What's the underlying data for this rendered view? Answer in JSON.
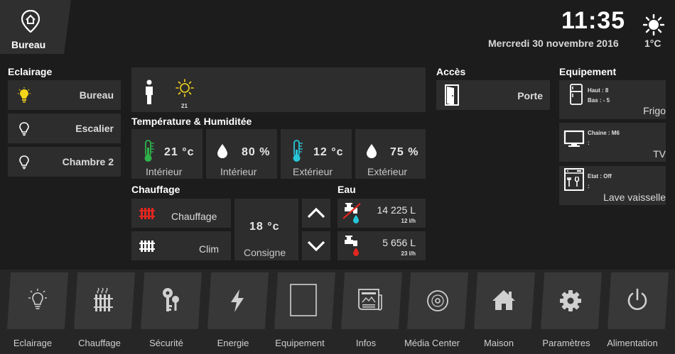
{
  "header": {
    "room": "Bureau",
    "time": "11:35",
    "date": "Mercredi 30 novembre 2016",
    "outside_temp": "1°C",
    "weather_icon": "sun-icon",
    "room_icon": "location-home-icon"
  },
  "lighting": {
    "title": "Eclairage",
    "items": [
      {
        "label": "Bureau",
        "state": "on",
        "icon": "bulb-on-icon"
      },
      {
        "label": "Escalier",
        "state": "off",
        "icon": "bulb-off-icon"
      },
      {
        "label": "Chambre 2",
        "state": "off",
        "icon": "bulb-off-icon"
      }
    ]
  },
  "presence": {
    "person_icon": "person-icon",
    "sun_icon": "sun-icon",
    "sun_value": "21"
  },
  "climate": {
    "title": "Température & Humiditée",
    "cards": [
      {
        "value": "21 °c",
        "label": "Intérieur",
        "icon": "thermometer-green-icon"
      },
      {
        "value": "80 %",
        "label": "Intérieur",
        "icon": "drop-icon"
      },
      {
        "value": "12 °c",
        "label": "Extérieur",
        "icon": "thermometer-cyan-icon"
      },
      {
        "value": "75 %",
        "label": "Extérieur",
        "icon": "drop-icon"
      }
    ]
  },
  "heating": {
    "title": "Chauffage",
    "modes": [
      {
        "label": "Chauffage",
        "icon": "radiator-red-icon"
      },
      {
        "label": "Clim",
        "icon": "radiator-white-icon"
      }
    ],
    "setpoint_value": "18 °c",
    "setpoint_label": "Consigne"
  },
  "water": {
    "title": "Eau",
    "rows": [
      {
        "total": "14 225 L",
        "rate": "12 l/h",
        "icon": "cold-water-tap-icon"
      },
      {
        "total": "5 656 L",
        "rate": "23 l/h",
        "icon": "hot-water-tap-icon"
      }
    ]
  },
  "access": {
    "title": "Accès",
    "door_label": "Porte",
    "icon": "door-icon"
  },
  "equipment": {
    "title": "Equipement",
    "items": [
      {
        "name": "Frigo",
        "line1": "Haut : 8",
        "line2": "Bas : - 5",
        "icon": "fridge-icon"
      },
      {
        "name": "TV",
        "line1": "Chaine : M6",
        "line2": ":",
        "icon": "tv-icon"
      },
      {
        "name": "Lave vaisselle",
        "line1": "Etat : Off",
        "line2": ":",
        "icon": "dishwasher-icon"
      }
    ]
  },
  "nav": [
    {
      "label": "Eclairage",
      "icon": "bulb-icon"
    },
    {
      "label": "Chauffage",
      "icon": "radiator-icon"
    },
    {
      "label": "Sécurité",
      "icon": "keys-icon"
    },
    {
      "label": "Energie",
      "icon": "lightning-icon"
    },
    {
      "label": "Equipement",
      "icon": "frame-icon"
    },
    {
      "label": "Infos",
      "icon": "newspaper-icon"
    },
    {
      "label": "Média Center",
      "icon": "disc-icon"
    },
    {
      "label": "Maison",
      "icon": "house-icon"
    },
    {
      "label": "Paramètres",
      "icon": "gear-icon"
    },
    {
      "label": "Alimentation",
      "icon": "power-icon"
    }
  ],
  "colors": {
    "bulb_on": "#f5d51a",
    "thermo_green": "#2fb34a",
    "thermo_cyan": "#27c6d9",
    "heat_red": "#e0261f",
    "water_cyan": "#27c6d9",
    "water_red": "#e0261f"
  }
}
